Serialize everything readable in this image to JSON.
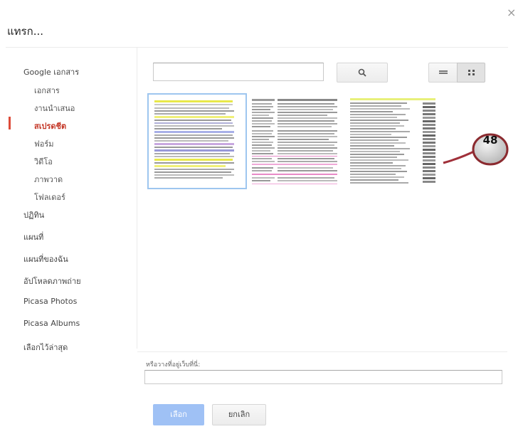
{
  "dialog": {
    "title": "แทรก...",
    "close_glyph": "×"
  },
  "sidebar": {
    "group_label": "Google เอกสาร",
    "sub_items": [
      {
        "label": "เอกสาร",
        "active": false
      },
      {
        "label": "งานนำเสนอ",
        "active": false
      },
      {
        "label": "สเปรดชีต",
        "active": true
      },
      {
        "label": "ฟอร์ม",
        "active": false
      },
      {
        "label": "วิดีโอ",
        "active": false
      },
      {
        "label": "ภาพวาด",
        "active": false
      },
      {
        "label": "โฟลเดอร์",
        "active": false
      }
    ],
    "items": [
      {
        "label": "ปฏิทิน"
      },
      {
        "label": "แผนที่"
      },
      {
        "label": "แผนที่ของฉัน"
      },
      {
        "label": "อัปโหลดภาพถ่าย"
      },
      {
        "label": "Picasa Photos"
      },
      {
        "label": "Picasa Albums"
      },
      {
        "label": "เลือกไว้ล่าสุด"
      }
    ]
  },
  "toolbar": {
    "search_value": "",
    "search_icon": "search-icon",
    "view_list_icon": "list-view-icon",
    "view_grid_icon": "grid-view-icon"
  },
  "annotation": {
    "number": "48"
  },
  "footer": {
    "url_label": "หรือวางที่อยู่เว็บที่นี่:",
    "url_value": "",
    "select_label": "เลือก",
    "cancel_label": "ยกเลิก"
  },
  "colors": {
    "accent_red": "#dd4b39",
    "select_button": "#9fc1f5",
    "selected_border": "#9ec6ef"
  }
}
